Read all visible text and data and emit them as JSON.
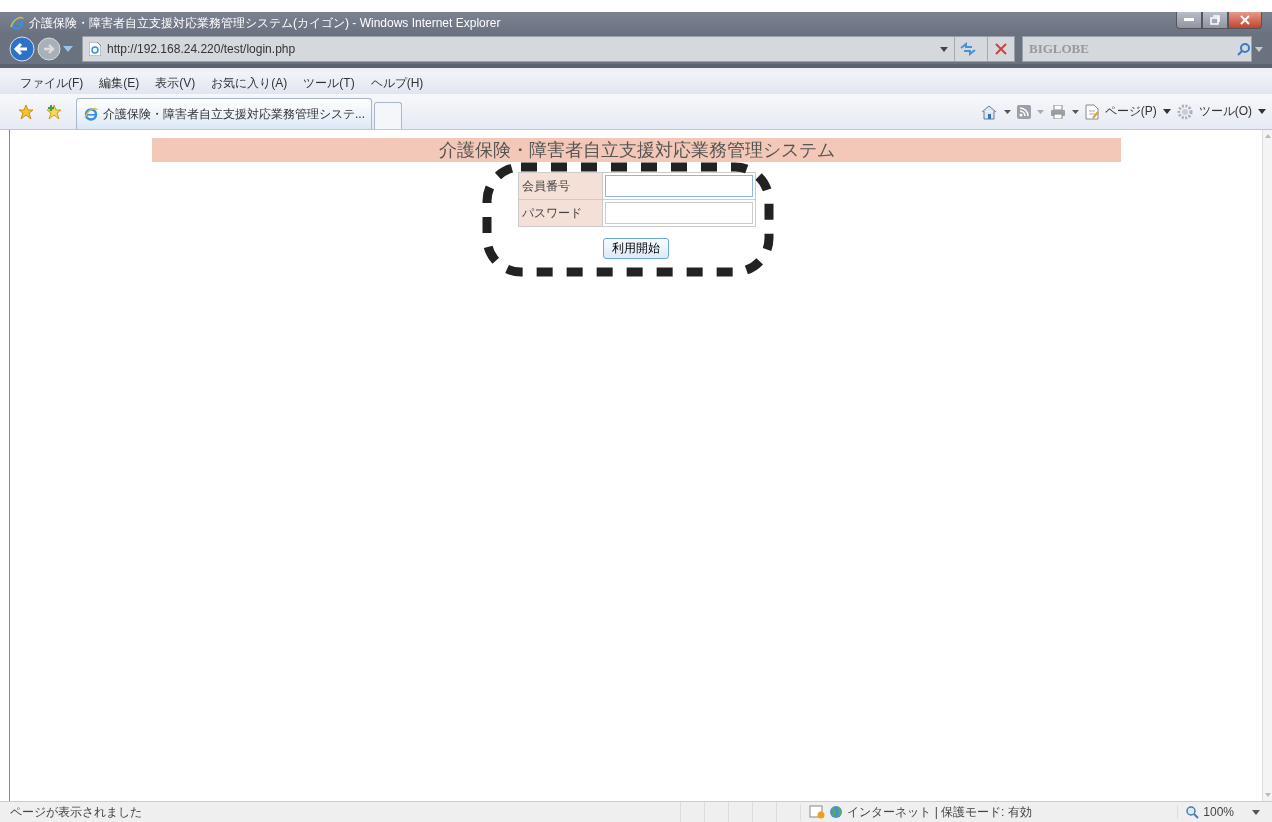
{
  "window": {
    "title": "介護保険・障害者自立支援対応業務管理システム(カイゴン) - Windows Internet Explorer"
  },
  "address_bar": {
    "url": "http://192.168.24.220/test/login.php"
  },
  "search": {
    "placeholder": "BIGLOBE"
  },
  "menu": [
    "ファイル(F)",
    "編集(E)",
    "表示(V)",
    "お気に入り(A)",
    "ツール(T)",
    "ヘルプ(H)"
  ],
  "tabs": [
    {
      "label": "介護保険・障害者自立支援対応業務管理システ...",
      "selected": true
    }
  ],
  "command_bar": [
    "ページ(P)",
    "ツール(O)"
  ],
  "page": {
    "heading": "介護保険・障害者自立支援対応業務管理システム",
    "fields": [
      {
        "label": "会員番号",
        "focused": true
      },
      {
        "label": "パスワード",
        "focused": false
      }
    ],
    "submit": "利用開始"
  },
  "status_bar": {
    "message": "ページが表示されました",
    "zone": "インターネット | 保護モード: 有効",
    "zoom": "100%"
  }
}
